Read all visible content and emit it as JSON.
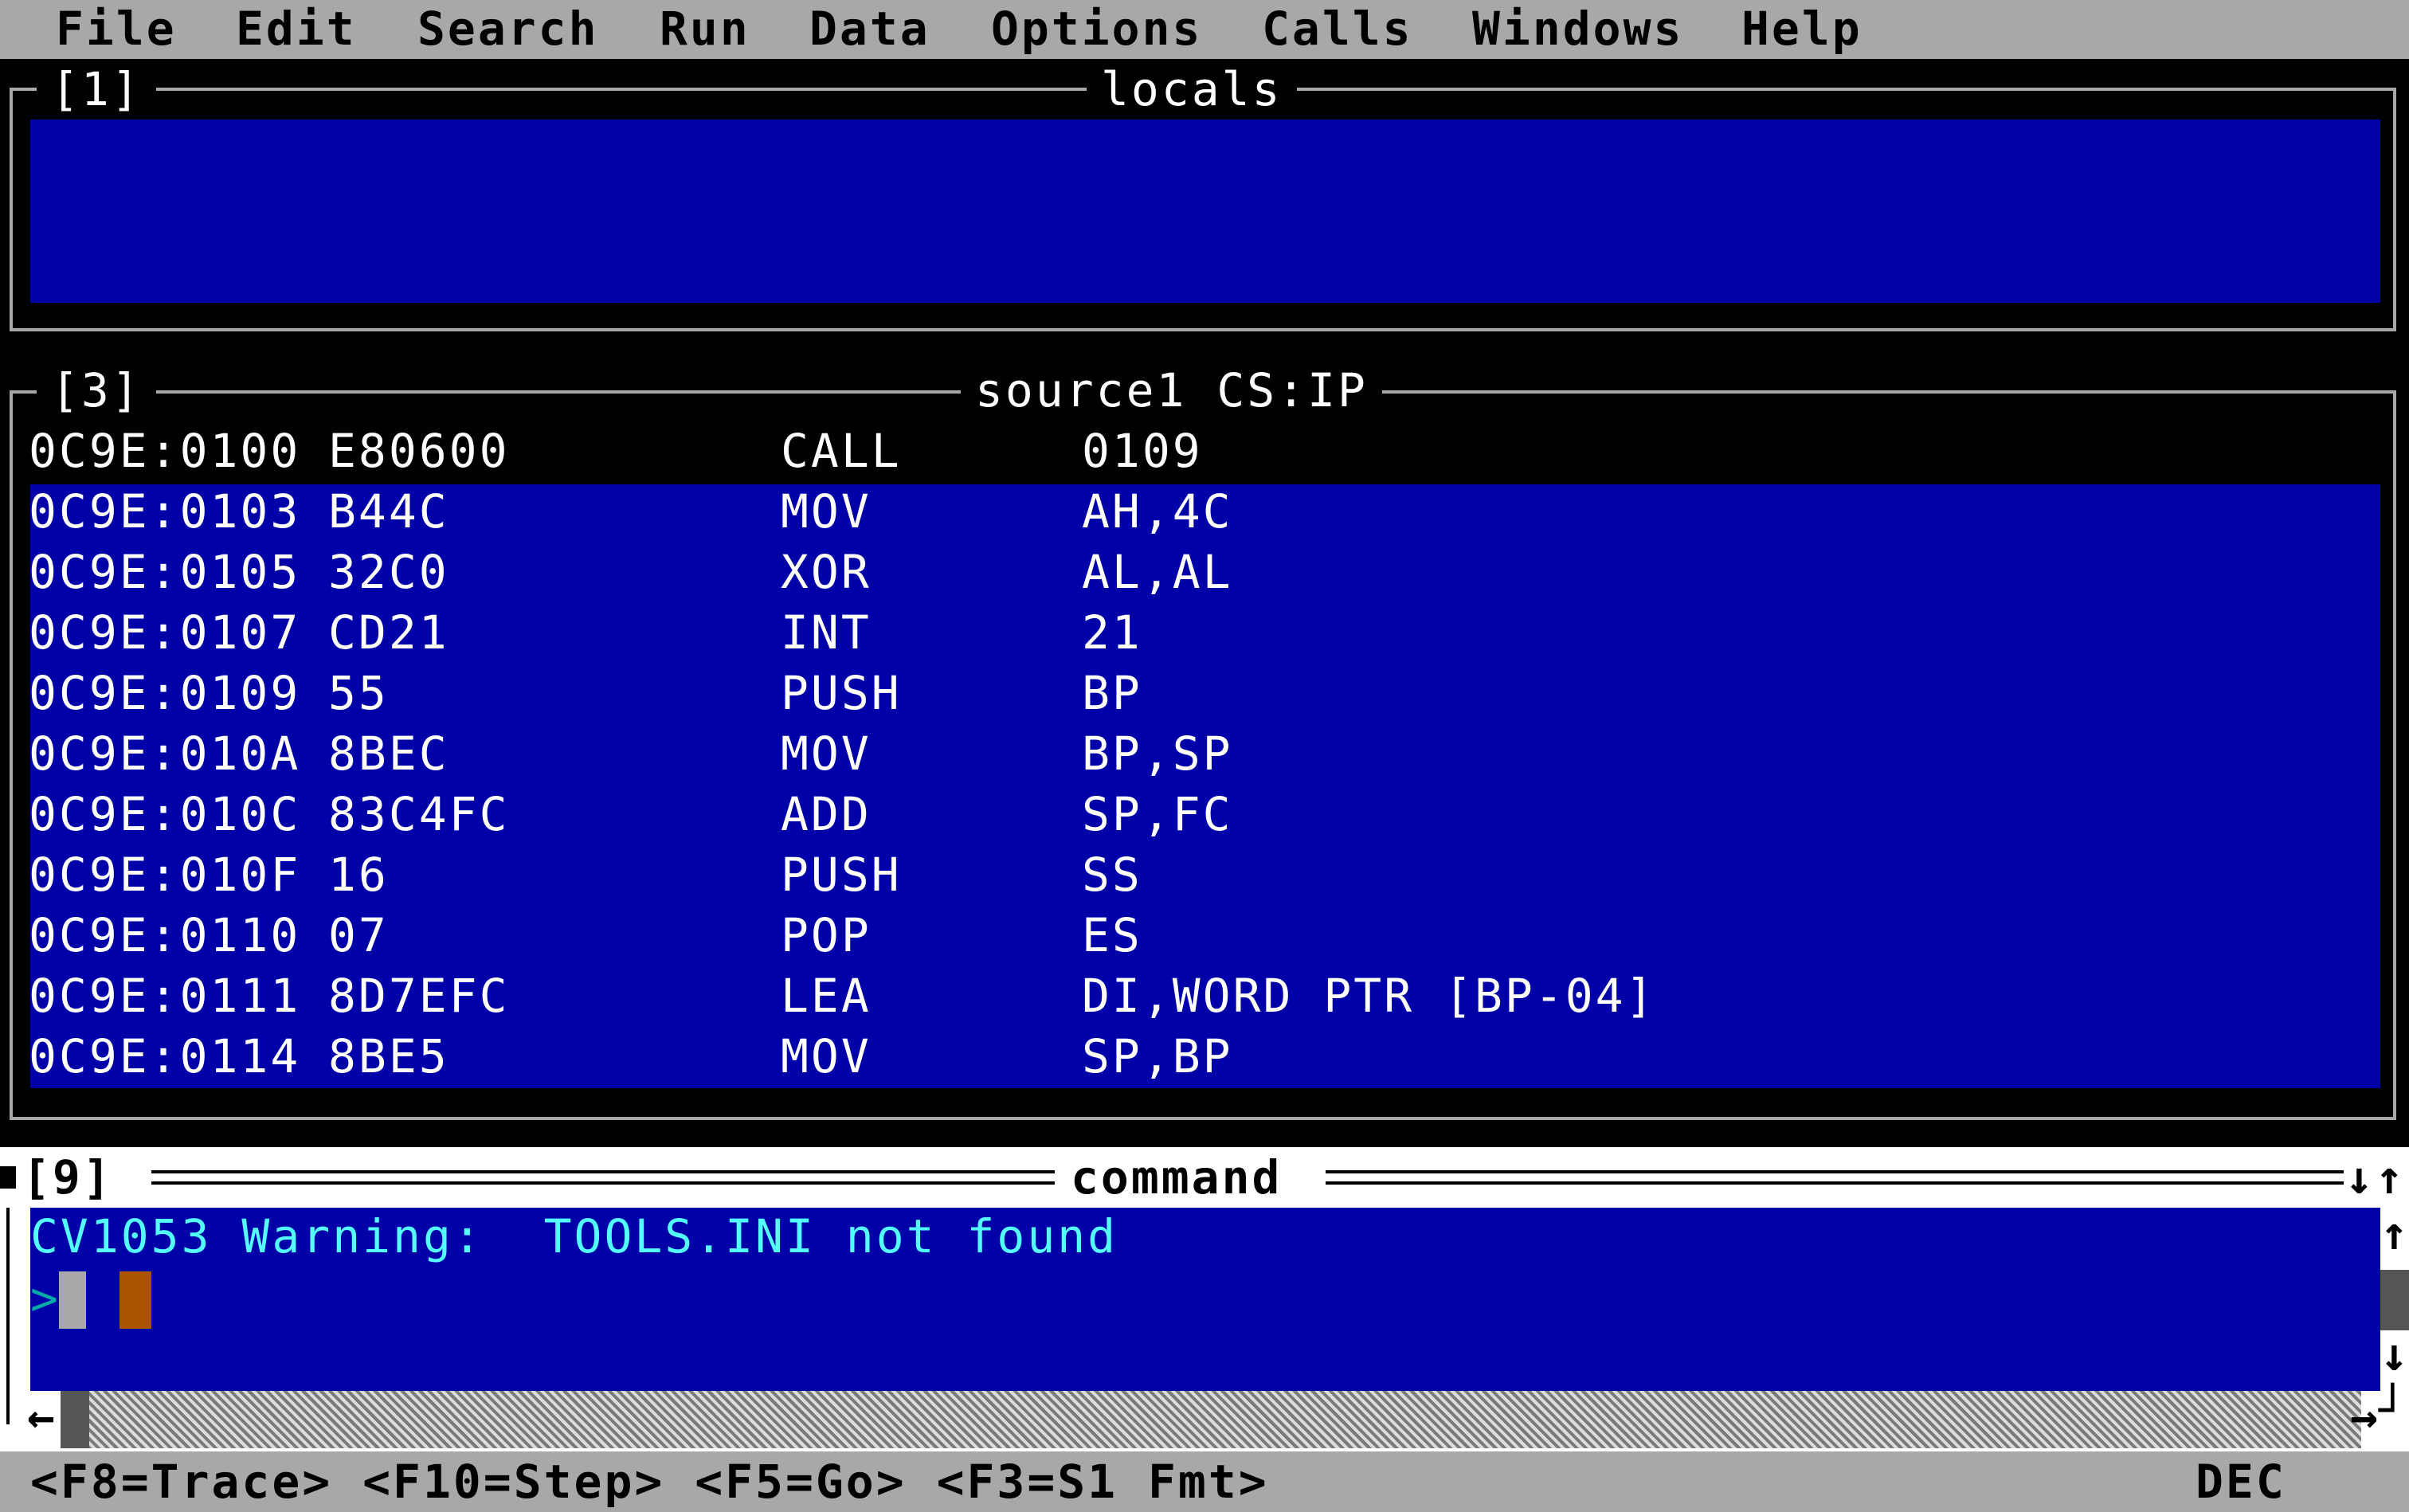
{
  "menu": [
    "File",
    "Edit",
    "Search",
    "Run",
    "Data",
    "Options",
    "Calls",
    "Windows",
    "Help"
  ],
  "locals": {
    "number": "[1]",
    "title": "locals"
  },
  "source": {
    "number": "[3]",
    "title": "source1 CS:IP",
    "rows": [
      {
        "addr": "0C9E:0100",
        "bytes": "E80600",
        "mnem": "CALL",
        "ops": "0109"
      },
      {
        "addr": "0C9E:0103",
        "bytes": "B44C",
        "mnem": "MOV",
        "ops": "AH,4C"
      },
      {
        "addr": "0C9E:0105",
        "bytes": "32C0",
        "mnem": "XOR",
        "ops": "AL,AL"
      },
      {
        "addr": "0C9E:0107",
        "bytes": "CD21",
        "mnem": "INT",
        "ops": "21"
      },
      {
        "addr": "0C9E:0109",
        "bytes": "55",
        "mnem": "PUSH",
        "ops": "BP"
      },
      {
        "addr": "0C9E:010A",
        "bytes": "8BEC",
        "mnem": "MOV",
        "ops": "BP,SP"
      },
      {
        "addr": "0C9E:010C",
        "bytes": "83C4FC",
        "mnem": "ADD",
        "ops": "SP,FC"
      },
      {
        "addr": "0C9E:010F",
        "bytes": "16",
        "mnem": "PUSH",
        "ops": "SS"
      },
      {
        "addr": "0C9E:0110",
        "bytes": "07",
        "mnem": "POP",
        "ops": "ES"
      },
      {
        "addr": "0C9E:0111",
        "bytes": "8D7EFC",
        "mnem": "LEA",
        "ops": "DI,WORD PTR [BP-04]"
      },
      {
        "addr": "0C9E:0114",
        "bytes": "8BE5",
        "mnem": "MOV",
        "ops": "SP,BP"
      }
    ]
  },
  "command": {
    "number": "[9]",
    "title": "command",
    "message": "CV1053 Warning:  TOOLS.INI not found",
    "prompt": ">"
  },
  "status": {
    "keys": "<F8=Trace> <F10=Step> <F5=Go> <F3=S1 Fmt>",
    "mode": "DEC"
  },
  "colors": {
    "background": "#000000",
    "window_blue": "#0000A8",
    "menubar": "#A8A8A8",
    "command_text": "#54FFFF",
    "cursor_highlight": "#A85400"
  }
}
